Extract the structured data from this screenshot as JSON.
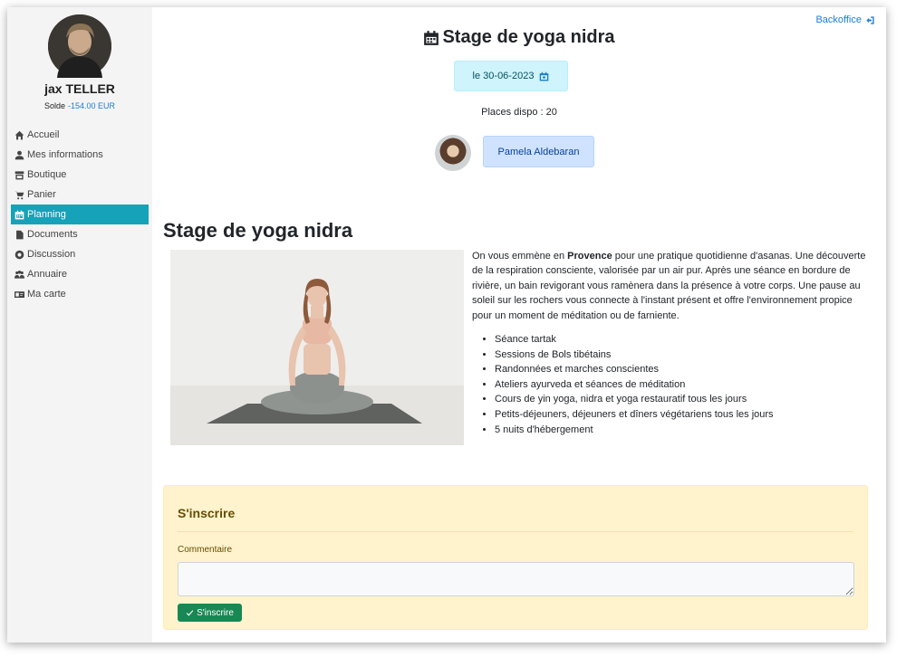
{
  "user": {
    "name": "jax TELLER",
    "balance_label": "Solde",
    "balance_value": "-154.00 EUR"
  },
  "sidebar": {
    "items": [
      {
        "label": "Accueil",
        "icon": "home-icon"
      },
      {
        "label": "Mes informations",
        "icon": "user-icon"
      },
      {
        "label": "Boutique",
        "icon": "store-icon"
      },
      {
        "label": "Panier",
        "icon": "cart-icon"
      },
      {
        "label": "Planning",
        "icon": "calendar-icon",
        "active": true
      },
      {
        "label": "Documents",
        "icon": "file-icon"
      },
      {
        "label": "Discussion",
        "icon": "chat-icon"
      },
      {
        "label": "Annuaire",
        "icon": "users-icon"
      },
      {
        "label": "Ma carte",
        "icon": "id-card-icon"
      }
    ]
  },
  "header": {
    "backoffice_label": "Backoffice"
  },
  "event": {
    "title": "Stage de yoga nidra",
    "date": "le 30-06-2023",
    "places": "Places dispo : 20",
    "teacher": "Pamela Aldebaran",
    "section_title": "Stage de yoga nidra",
    "desc_pre": "On vous emmène en ",
    "desc_bold": "Provence",
    "desc_post": " pour une pratique quotidienne d'asanas. Une découverte de la respiration consciente, valorisée par un air pur. Après une séance en bordure de rivière, un bain revigorant vous ramènera dans la présence à votre corps. Une pause au soleil sur les rochers vous connecte à l'instant présent et offre l'environnement propice pour un moment de méditation ou de farniente.",
    "features": [
      "Séance tartak",
      "Sessions de Bols tibétains",
      "Randonnées et marches conscientes",
      "Ateliers ayurveda et séances de méditation",
      "Cours de yin yoga, nidra et yoga restauratif tous les jours",
      "Petits-déjeuners, déjeuners et dîners végétariens tous les jours",
      "5 nuits d'hébergement"
    ]
  },
  "signup": {
    "heading": "S'inscrire",
    "comment_label": "Commentaire",
    "comment_value": "",
    "button_label": "S'inscrire"
  },
  "colors": {
    "accent": "#16a2b8",
    "link": "#1a7dd7",
    "success": "#198754",
    "warning_bg": "#fff3cd",
    "info_bg": "#cff4fc",
    "primary_bg": "#cfe2ff"
  }
}
